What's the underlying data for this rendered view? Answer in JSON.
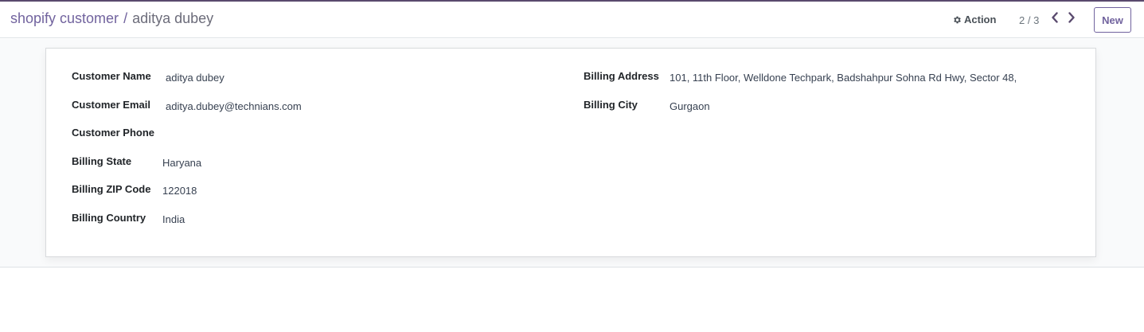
{
  "header": {
    "breadcrumb_parent": "shopify customer",
    "breadcrumb_separator": "/",
    "breadcrumb_current": "aditya dubey",
    "action_label": "Action",
    "action_icon": "gear-icon",
    "pager_value": "2 / 3",
    "prev_icon": "chevron-left-icon",
    "next_icon": "chevron-right-icon",
    "new_label": "New"
  },
  "form": {
    "customer_name_label": "Customer Name",
    "customer_name_value": "aditya dubey",
    "customer_email_label": "Customer Email",
    "customer_email_value": "aditya.dubey@technians.com",
    "customer_phone_label": "Customer Phone",
    "customer_phone_value": "",
    "billing_state_label": "Billing State",
    "billing_state_value": "Haryana",
    "billing_zip_label": "Billing ZIP Code",
    "billing_zip_value": "122018",
    "billing_country_label": "Billing Country",
    "billing_country_value": "India",
    "billing_address_label": "Billing Address",
    "billing_address_value": "101, 11th Floor, Welldone Techpark, Badshahpur Sohna Rd Hwy, Sector 48,",
    "billing_city_label": "Billing City",
    "billing_city_value": "Gurgaon"
  },
  "colors": {
    "accent": "#71639e",
    "top_bar": "#5a4a6e",
    "background": "#f9fafb"
  }
}
